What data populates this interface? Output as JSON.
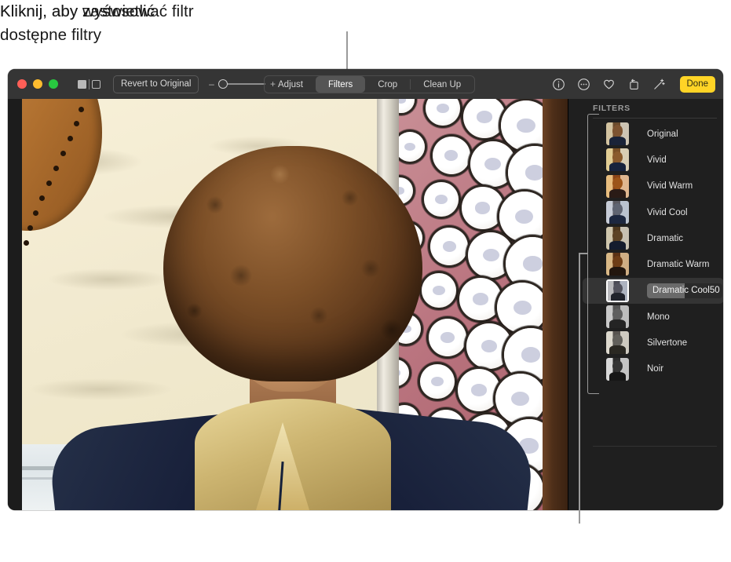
{
  "callouts": {
    "top": "Kliknij, aby wyświetlić\ndostępne filtry",
    "bottom": "Kliknij, aby zastosować filtr"
  },
  "window": {
    "traffic_lights": [
      "close",
      "minimize",
      "zoom"
    ],
    "view_toggle": {
      "name": "view-mode-toggle"
    },
    "revert_label": "Revert to Original",
    "zoom_slider": {
      "minus": "–",
      "plus": "+",
      "value": 0
    },
    "segmented": {
      "items": [
        {
          "label": "Adjust",
          "active": false
        },
        {
          "label": "Filters",
          "active": true
        },
        {
          "label": "Crop",
          "active": false
        },
        {
          "label": "Clean Up",
          "active": false
        }
      ]
    },
    "right_icons": [
      {
        "name": "info-icon"
      },
      {
        "name": "more-options-icon"
      },
      {
        "name": "favorite-heart-icon"
      },
      {
        "name": "rotate-icon"
      },
      {
        "name": "auto-enhance-icon"
      }
    ],
    "done_label": "Done"
  },
  "sidebar": {
    "title": "FILTERS",
    "filters": [
      {
        "label": "Original",
        "selected": false,
        "value": null
      },
      {
        "label": "Vivid",
        "selected": false,
        "value": null
      },
      {
        "label": "Vivid Warm",
        "selected": false,
        "value": null
      },
      {
        "label": "Vivid Cool",
        "selected": false,
        "value": null
      },
      {
        "label": "Dramatic",
        "selected": false,
        "value": null
      },
      {
        "label": "Dramatic Warm",
        "selected": false,
        "value": null
      },
      {
        "label": "Dramatic Cool",
        "selected": true,
        "value": "50"
      },
      {
        "label": "Mono",
        "selected": false,
        "value": null
      },
      {
        "label": "Silvertone",
        "selected": false,
        "value": null
      },
      {
        "label": "Noir",
        "selected": false,
        "value": null
      }
    ]
  },
  "colors": {
    "accent_done": "#ffd426",
    "toolbar_bg": "#353535",
    "sidebar_bg": "#1f1f1f",
    "selected_row": "#343434",
    "callout_line": "#9a9a9a"
  },
  "photo": {
    "description": "Portrait of a person with curly hair in a navy jacket and gold hoodie, standing beside a sunlit wall and a display of white plates"
  }
}
